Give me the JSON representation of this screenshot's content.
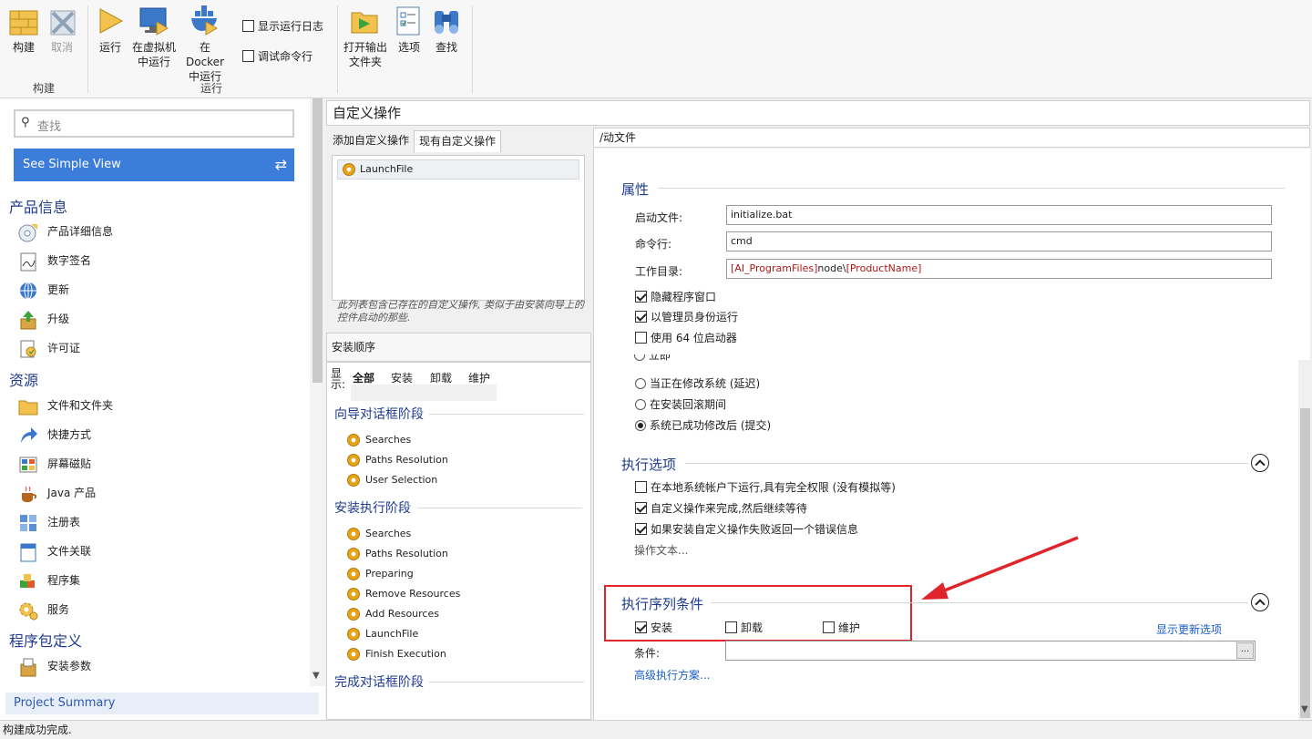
{
  "ribbon": {
    "build_group": {
      "label": "构建",
      "build": "构建",
      "build_arrow": "▾",
      "cancel": "取消"
    },
    "run_group": {
      "label": "运行",
      "run": "运行",
      "run_vm": "在虚拟机中运行",
      "run_docker": "在Docker中运行",
      "show_log": "显示运行日志",
      "debug_cmd": "调试命令行"
    },
    "tools": {
      "open_output": "打开输出文件夹",
      "options": "选项",
      "find": "查找"
    }
  },
  "left": {
    "search_placeholder": "查找",
    "simple_view": "See Simple View",
    "categories": [
      {
        "title": "产品信息",
        "items": [
          "产品详细信息",
          "数字签名",
          "更新",
          "升级",
          "许可证"
        ]
      },
      {
        "title": "资源",
        "items": [
          "文件和文件夹",
          "快捷方式",
          "屏幕磁贴",
          "Java 产品",
          "注册表",
          "文件关联",
          "程序集",
          "服务"
        ]
      },
      {
        "title": "程序包定义",
        "items": [
          "安装参数"
        ]
      }
    ],
    "project_summary": "Project Summary"
  },
  "status": "构建成功完成.",
  "center": {
    "title": "自定义操作",
    "tabs": [
      "添加自定义操作",
      "现有自定义操作"
    ],
    "actions": [
      "LaunchFile"
    ],
    "note": "此列表包含已存在的自定义操作, 类似于由安装向导上的 控件启动的那些.",
    "sequence_title": "安装顺序",
    "filter": {
      "label": "显示:",
      "options": [
        "全部",
        "安装",
        "卸载",
        "维护"
      ]
    },
    "phases": [
      {
        "title": "向导对话框阶段",
        "items": [
          "Searches",
          "Paths Resolution",
          "User Selection"
        ]
      },
      {
        "title": "安装执行阶段",
        "items": [
          "Searches",
          "Paths Resolution",
          "Preparing",
          "Remove Resources",
          "Add Resources",
          "LaunchFile",
          "Finish Execution"
        ]
      },
      {
        "title": "完成对话框阶段",
        "items": []
      }
    ]
  },
  "right": {
    "header": "/动文件",
    "properties": {
      "title": "属性",
      "launch_label": "启动文件:",
      "launch_value": "initialize.bat",
      "cmd_label": "命令行:",
      "cmd_value": "cmd",
      "workdir_label": "工作目录:",
      "workdir_prefix": "[AI_ProgramFiles]",
      "workdir_mid": "node\\",
      "workdir_suffix": "[ProductName]",
      "hide_window": "隐藏程序窗口",
      "run_admin": "以管理员身份运行",
      "use64": "使用 64 位启动器"
    },
    "timing": [
      "立即",
      "当正在修改系统 (延迟)",
      "在安装回滚期间",
      "系统已成功修改后 (提交)"
    ],
    "exec_options": {
      "title": "执行选项",
      "opt1": "在本地系统帐户下运行,具有完全权限 (没有模拟等)",
      "opt2": "自定义操作来完成,然后继续等待",
      "opt3": "如果安装自定义操作失败返回一个错误信息",
      "action_text": "操作文本..."
    },
    "seq_conditions": {
      "title": "执行序列条件",
      "install": "安装",
      "uninstall": "卸载",
      "maintenance": "维护",
      "show_update": "显示更新选项",
      "condition_label": "条件:",
      "browse": "...",
      "advanced": "高级执行方案..."
    }
  },
  "colors": {
    "accent": "#3c7dd9",
    "section": "#1f3b8f",
    "highlight_box": "#e0242c"
  }
}
